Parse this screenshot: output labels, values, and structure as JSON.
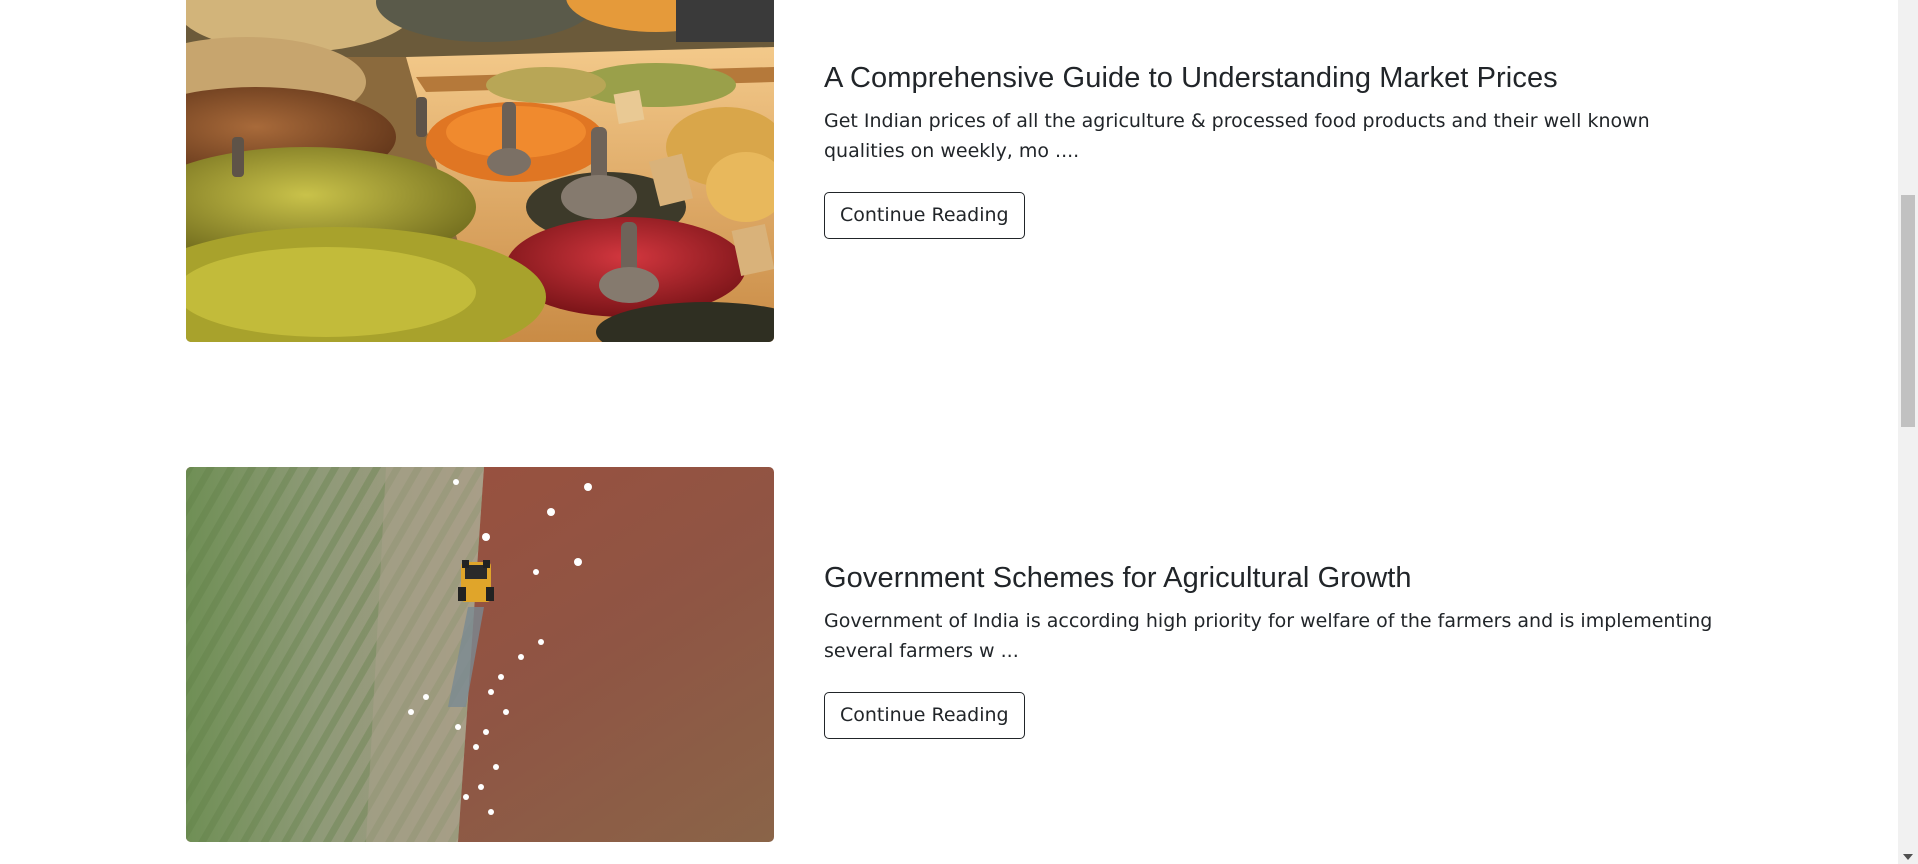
{
  "posts": [
    {
      "title": "A Comprehensive Guide to Understanding Market Prices",
      "excerpt": "Get Indian prices of all the agriculture & processed food products and their well known qualities on weekly, mo ....",
      "button_label": "Continue Reading",
      "image": "spice-market-photo"
    },
    {
      "title": "Government Schemes for Agricultural Growth",
      "excerpt": "Government of India is according high priority for welfare of the farmers and is implementing several farmers w ...",
      "button_label": "Continue Reading",
      "image": "tractor-field-aerial-photo"
    }
  ],
  "colors": {
    "text": "#212529",
    "button_border": "#212529",
    "scrollbar_track": "#f1f1f1",
    "scrollbar_thumb": "#c1c1c1"
  }
}
